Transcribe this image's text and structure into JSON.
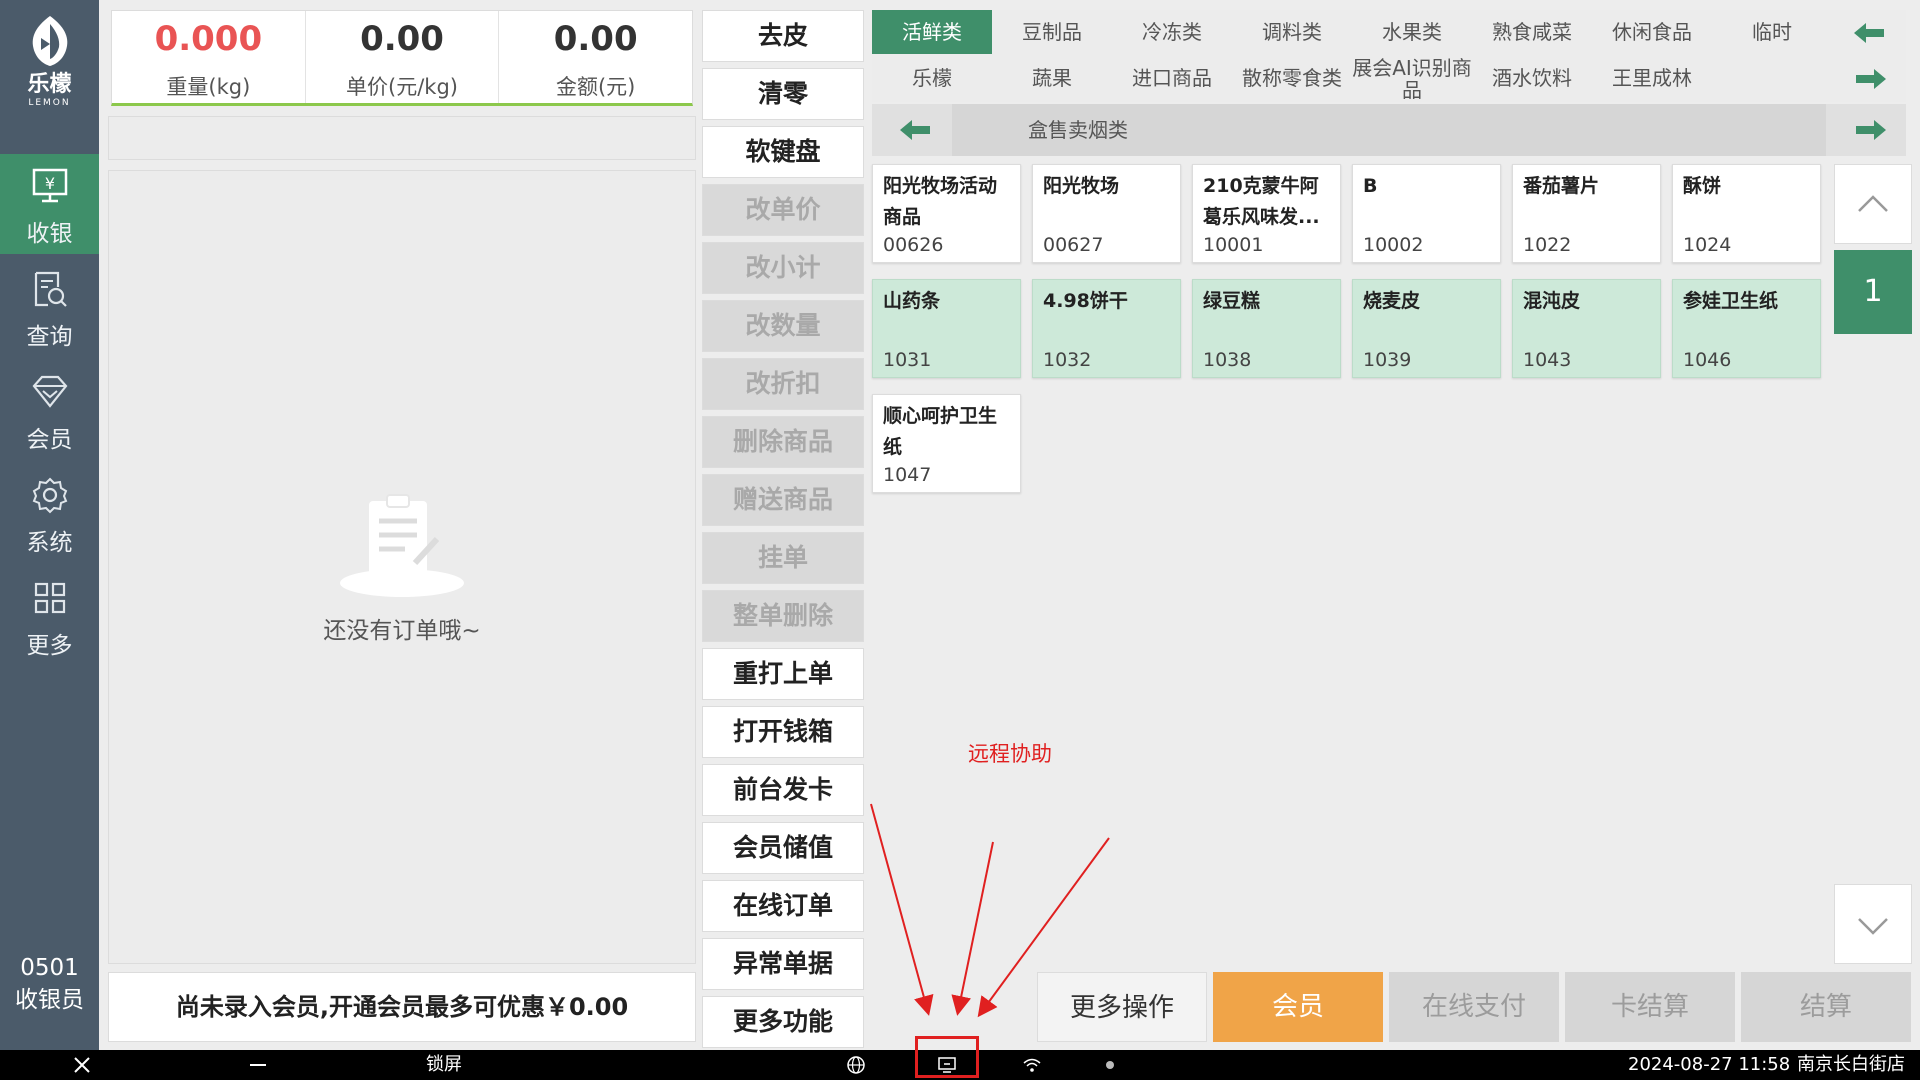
{
  "brand": {
    "name": "乐檬",
    "sub": "LEMON"
  },
  "sidebar": {
    "items": [
      {
        "label": "收银",
        "icon": "cashier-icon",
        "active": true
      },
      {
        "label": "查询",
        "icon": "query-icon",
        "active": false
      },
      {
        "label": "会员",
        "icon": "diamond-icon",
        "active": false
      },
      {
        "label": "系统",
        "icon": "gear-icon",
        "active": false
      },
      {
        "label": "更多",
        "icon": "grid-icon",
        "active": false
      }
    ],
    "cashier_id": "0501",
    "cashier_role": "收银员"
  },
  "scale": {
    "weight": "0.000",
    "weight_label": "重量(kg)",
    "unit_price": "0.00",
    "unit_price_label": "单价(元/kg)",
    "amount": "0.00",
    "amount_label": "金额(元)"
  },
  "order": {
    "empty_text": "还没有订单哦~"
  },
  "member_bar": "尚未录入会员,开通会员最多可优惠￥0.00",
  "functions": [
    {
      "label": "去皮",
      "enabled": true
    },
    {
      "label": "清零",
      "enabled": true
    },
    {
      "label": "软键盘",
      "enabled": true
    },
    {
      "label": "改单价",
      "enabled": false
    },
    {
      "label": "改小计",
      "enabled": false
    },
    {
      "label": "改数量",
      "enabled": false
    },
    {
      "label": "改折扣",
      "enabled": false
    },
    {
      "label": "删除商品",
      "enabled": false
    },
    {
      "label": "赠送商品",
      "enabled": false
    },
    {
      "label": "挂单",
      "enabled": false
    },
    {
      "label": "整单删除",
      "enabled": false
    },
    {
      "label": "重打上单",
      "enabled": true
    },
    {
      "label": "打开钱箱",
      "enabled": true
    },
    {
      "label": "前台发卡",
      "enabled": true
    },
    {
      "label": "会员储值",
      "enabled": true
    },
    {
      "label": "在线订单",
      "enabled": true
    },
    {
      "label": "异常单据",
      "enabled": true
    },
    {
      "label": "更多功能",
      "enabled": true
    }
  ],
  "categories": {
    "row1": [
      "活鲜类",
      "豆制品",
      "冷冻类",
      "调料类",
      "水果类",
      "熟食咸菜",
      "休闲食品",
      "临时"
    ],
    "row2": [
      "乐檬",
      "蔬果",
      "进口商品",
      "散称零食类",
      "展会AI识别商品",
      "酒水饮料",
      "王里成林"
    ],
    "active": "活鲜类",
    "sub": "盒售卖烟类"
  },
  "products": [
    {
      "name": "阳光牧场活动商品",
      "code": "00626",
      "green": false
    },
    {
      "name": "阳光牧场",
      "code": "00627",
      "green": false
    },
    {
      "name": "210克蒙牛阿葛乐风味发...",
      "code": "10001",
      "green": false
    },
    {
      "name": "B",
      "code": "10002",
      "green": false
    },
    {
      "name": "番茄薯片",
      "code": "1022",
      "green": false
    },
    {
      "name": "酥饼",
      "code": "1024",
      "green": false
    },
    {
      "name": "山药条",
      "code": "1031",
      "green": true
    },
    {
      "name": "4.98饼干",
      "code": "1032",
      "green": true
    },
    {
      "name": "绿豆糕",
      "code": "1038",
      "green": true
    },
    {
      "name": "烧麦皮",
      "code": "1039",
      "green": true
    },
    {
      "name": "混沌皮",
      "code": "1043",
      "green": true
    },
    {
      "name": "参娃卫生纸",
      "code": "1046",
      "green": true
    },
    {
      "name": "顺心呵护卫生纸",
      "code": "1047",
      "green": false
    }
  ],
  "pager": {
    "page": "1"
  },
  "actions": {
    "more": "更多操作",
    "member": "会员",
    "online_pay": "在线支付",
    "card_pay": "卡结算",
    "checkout": "结算"
  },
  "annotation": "远程协助",
  "taskbar": {
    "lock": "锁屏",
    "datetime": "2024-08-27 11:58",
    "store": "南京长白街店"
  },
  "colors": {
    "sidebar": "#4b5b6a",
    "accent_green": "#3f8f6a",
    "card_green": "#cde9d9",
    "member_orange": "#f0a448",
    "weight_red": "#e95454",
    "annotation_red": "#e02020"
  }
}
